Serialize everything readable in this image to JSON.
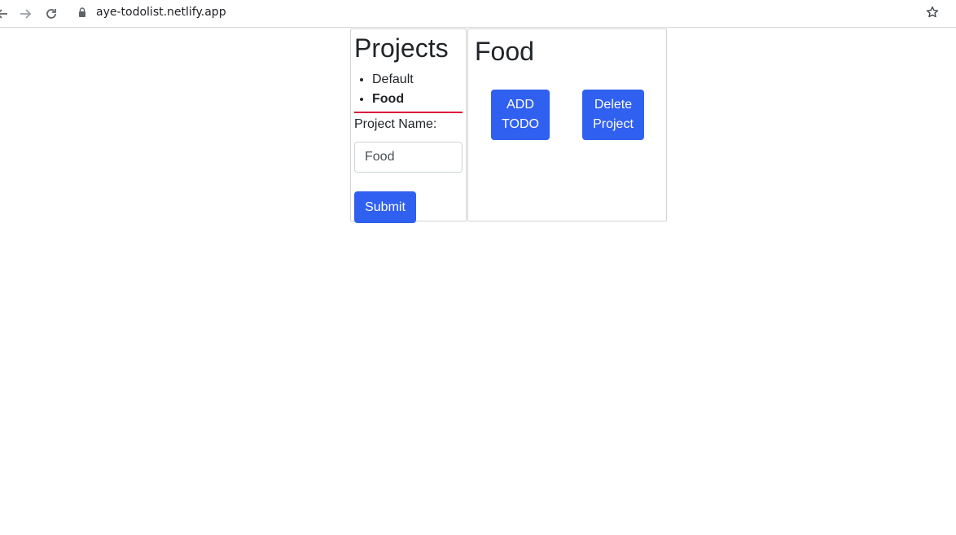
{
  "browser": {
    "url": "aye-todolist.netlify.app",
    "icons": [
      "back-icon",
      "forward-icon",
      "reload-icon",
      "lock-icon",
      "star-icon"
    ]
  },
  "sidebar": {
    "title": "Projects",
    "projects": [
      {
        "label": "Default",
        "active": false
      },
      {
        "label": "Food",
        "active": true
      }
    ],
    "form": {
      "label": "Project Name:",
      "input_value": "Food",
      "submit_label": "Submit"
    }
  },
  "main": {
    "title": "Food",
    "add_todo_label": "ADD TODO",
    "delete_project_label": "Delete Project"
  },
  "colors": {
    "primary": "#3060f0",
    "divider": "#dc143c",
    "border": "#d3d3d3"
  }
}
